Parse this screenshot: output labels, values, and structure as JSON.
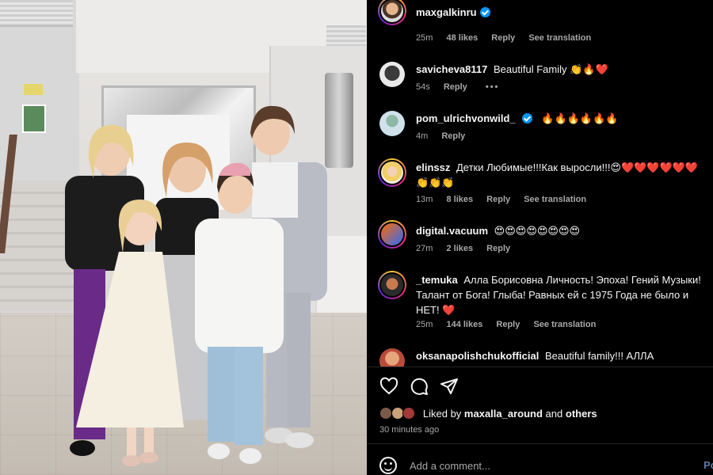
{
  "post": {
    "username": "maxgalkinru",
    "top_meta": {
      "time": "25m",
      "likes": "48 likes",
      "reply": "Reply",
      "translate": "See translation"
    }
  },
  "comments": [
    {
      "user": "savicheva8117",
      "text": "Beautiful Family 👏🔥❤️",
      "time": "54s",
      "reply": "Reply",
      "more": "•••",
      "verified": false
    },
    {
      "user": "pom_ulrichvonwild_",
      "text": "🔥🔥🔥🔥🔥🔥",
      "time": "4m",
      "reply": "Reply",
      "verified": true
    },
    {
      "user": "elinssz",
      "text": "Детки Любимые!!!Как выросли!!!😍❤️❤️❤️❤️❤️❤️👏👏👏",
      "time": "13m",
      "likes": "8 likes",
      "reply": "Reply",
      "translate": "See translation",
      "verified": false
    },
    {
      "user": "digital.vacuum",
      "text": "😍😍😍😍😍😍😍😍",
      "time": "27m",
      "likes": "2 likes",
      "reply": "Reply",
      "verified": false
    },
    {
      "user": "_temuka",
      "text": "Алла Борисовна Личность! Эпоха! Гений Музыки! Талант от Бога! Глыба! Равных ей с 1975 Года не было и НЕТ! ❤️",
      "time": "25m",
      "likes": "144 likes",
      "reply": "Reply",
      "translate": "See translation",
      "verified": false
    },
    {
      "user": "oksanapolishchukofficial",
      "text": "Beautiful family!!! АЛЛА",
      "verified": false
    }
  ],
  "liked_by": {
    "prefix": "Liked by",
    "user": "maxalla_around",
    "joiner": "and",
    "others": "others"
  },
  "time_ago": "30 minutes ago",
  "add_comment": {
    "placeholder": "Add a comment...",
    "post_label": "Po"
  },
  "icons": {
    "like": "heart-icon",
    "comment": "comment-icon",
    "share": "share-icon",
    "verified": "verified-badge-icon",
    "emoji": "emoji-icon"
  },
  "colors": {
    "background": "#000000",
    "text": "#f5f5f5",
    "muted": "#a8a8a8",
    "verified": "#0095f6"
  }
}
